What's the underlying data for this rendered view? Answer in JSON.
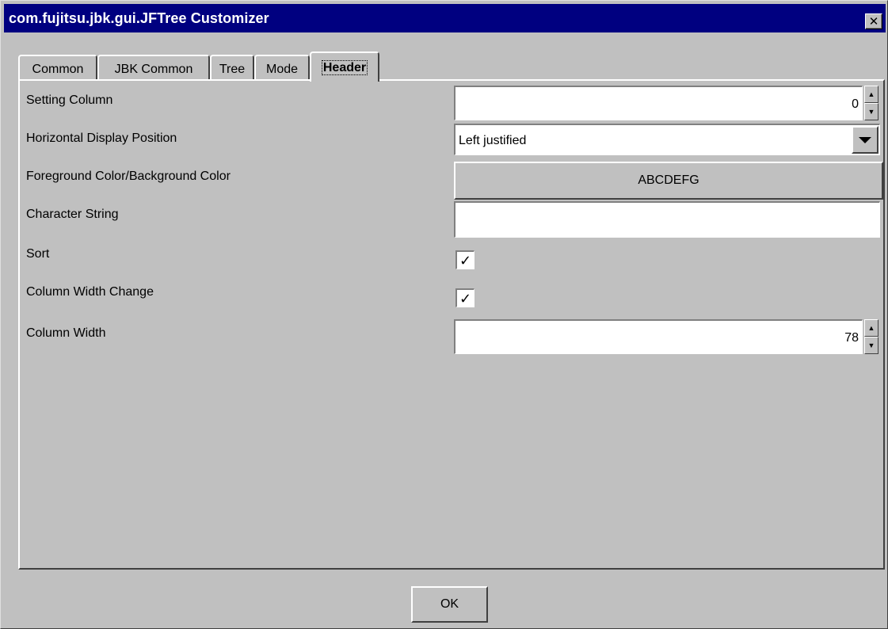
{
  "window": {
    "title": "com.fujitsu.jbk.gui.JFTree Customizer",
    "close_label": "✕"
  },
  "tabs": [
    {
      "label": "Common"
    },
    {
      "label": "JBK Common"
    },
    {
      "label": "Tree"
    },
    {
      "label": "Mode"
    },
    {
      "label": "Header",
      "active": true
    }
  ],
  "header_panel": {
    "setting_column": {
      "label": "Setting Column",
      "value": "0"
    },
    "horizontal_display_position": {
      "label": "Horizontal Display Position",
      "value": "Left justified"
    },
    "fg_bg_color": {
      "label": "Foreground Color/Background Color",
      "sample": "ABCDEFG"
    },
    "character_string": {
      "label": "Character String",
      "value": ""
    },
    "sort": {
      "label": "Sort",
      "checked": true,
      "mark": "✓"
    },
    "column_width_change": {
      "label": "Column Width Change",
      "checked": true,
      "mark": "✓"
    },
    "column_width": {
      "label": "Column Width",
      "value": "78"
    }
  },
  "footer": {
    "ok_label": "OK"
  },
  "colors": {
    "titlebar": "#000080",
    "face": "#c0c0c0"
  }
}
